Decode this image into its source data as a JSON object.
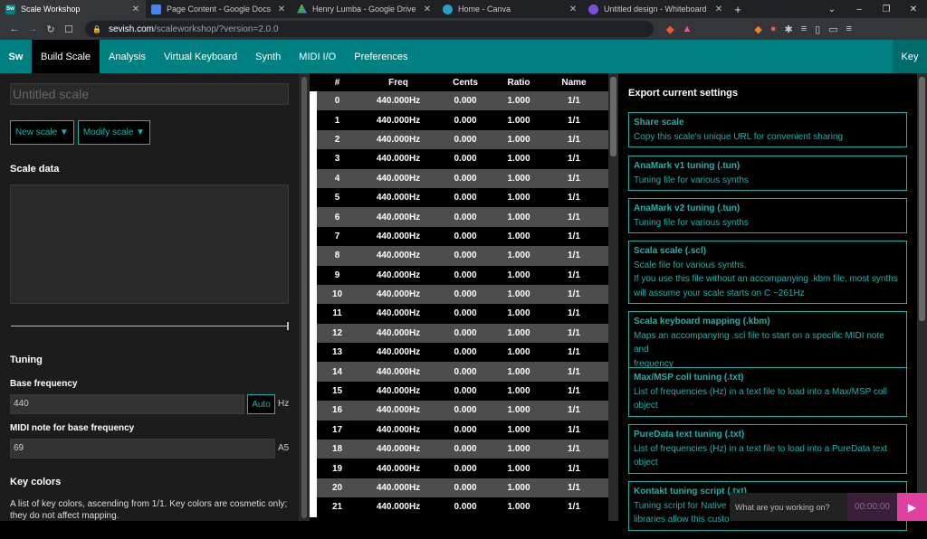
{
  "browser": {
    "tabs": [
      {
        "title": "Scale Workshop",
        "icon": "Sw",
        "active": true
      },
      {
        "title": "Page Content - Google Docs",
        "icon": "docs-icon",
        "active": false
      },
      {
        "title": "Henry Lumba - Google Drive",
        "icon": "drive-icon",
        "active": false
      },
      {
        "title": "Home - Canva",
        "icon": "canva-icon",
        "active": false
      },
      {
        "title": "Untitled design - Whiteboard",
        "icon": "canva-icon",
        "active": false
      }
    ],
    "url_host": "sevish.com",
    "url_path": "/scaleworkshop/?version=2.0.0"
  },
  "app": {
    "logo": "Sw",
    "nav": [
      "Build Scale",
      "Analysis",
      "Virtual Keyboard",
      "Synth",
      "MIDI I/O",
      "Preferences"
    ],
    "key_button": "Key"
  },
  "left": {
    "title_placeholder": "Untitled scale",
    "new_scale": "New scale ▼",
    "modify_scale": "Modify scale ▼",
    "scale_data_label": "Scale data",
    "tuning_label": "Tuning",
    "base_freq_label": "Base frequency",
    "base_freq_value": "440",
    "auto_button": "Auto",
    "hz_unit": "Hz",
    "midi_note_label": "MIDI note for base frequency",
    "midi_note_value": "69",
    "midi_note_name": "A5",
    "key_colors_label": "Key colors",
    "key_colors_desc": "A list of key colors, ascending from 1/1. Key colors are cosmetic only; they do not affect mapping."
  },
  "table": {
    "headers": [
      "#",
      "Freq",
      "Cents",
      "Ratio",
      "Name"
    ],
    "rows": [
      [
        "0",
        "440.000Hz",
        "0.000",
        "1.000",
        "1/1"
      ],
      [
        "1",
        "440.000Hz",
        "0.000",
        "1.000",
        "1/1"
      ],
      [
        "2",
        "440.000Hz",
        "0.000",
        "1.000",
        "1/1"
      ],
      [
        "3",
        "440.000Hz",
        "0.000",
        "1.000",
        "1/1"
      ],
      [
        "4",
        "440.000Hz",
        "0.000",
        "1.000",
        "1/1"
      ],
      [
        "5",
        "440.000Hz",
        "0.000",
        "1.000",
        "1/1"
      ],
      [
        "6",
        "440.000Hz",
        "0.000",
        "1.000",
        "1/1"
      ],
      [
        "7",
        "440.000Hz",
        "0.000",
        "1.000",
        "1/1"
      ],
      [
        "8",
        "440.000Hz",
        "0.000",
        "1.000",
        "1/1"
      ],
      [
        "9",
        "440.000Hz",
        "0.000",
        "1.000",
        "1/1"
      ],
      [
        "10",
        "440.000Hz",
        "0.000",
        "1.000",
        "1/1"
      ],
      [
        "11",
        "440.000Hz",
        "0.000",
        "1.000",
        "1/1"
      ],
      [
        "12",
        "440.000Hz",
        "0.000",
        "1.000",
        "1/1"
      ],
      [
        "13",
        "440.000Hz",
        "0.000",
        "1.000",
        "1/1"
      ],
      [
        "14",
        "440.000Hz",
        "0.000",
        "1.000",
        "1/1"
      ],
      [
        "15",
        "440.000Hz",
        "0.000",
        "1.000",
        "1/1"
      ],
      [
        "16",
        "440.000Hz",
        "0.000",
        "1.000",
        "1/1"
      ],
      [
        "17",
        "440.000Hz",
        "0.000",
        "1.000",
        "1/1"
      ],
      [
        "18",
        "440.000Hz",
        "0.000",
        "1.000",
        "1/1"
      ],
      [
        "19",
        "440.000Hz",
        "0.000",
        "1.000",
        "1/1"
      ],
      [
        "20",
        "440.000Hz",
        "0.000",
        "1.000",
        "1/1"
      ],
      [
        "21",
        "440.000Hz",
        "0.000",
        "1.000",
        "1/1"
      ]
    ]
  },
  "export": {
    "heading": "Export current settings",
    "cards": [
      {
        "title": "Share scale",
        "lines": [
          "Copy this scale's unique URL for convenient sharing"
        ]
      },
      {
        "title": "AnaMark v1 tuning (.tun)",
        "lines": [
          "Tuning file for various synths"
        ]
      },
      {
        "title": "AnaMark v2 tuning (.tun)",
        "lines": [
          "Tuning file for various synths"
        ]
      },
      {
        "title": "Scala scale (.scl)",
        "lines": [
          "Scale file for various synths.",
          "If you use this file without an accompanying .kbm file, most synths",
          "will assume your scale starts on C ~261Hz"
        ]
      },
      {
        "title": "Scala keyboard mapping (.kbm)",
        "lines": [
          "Maps an accompanying .scl file to start on a specific MIDI note and",
          "frequency"
        ]
      },
      {
        "title": "Max/MSP coll tuning (.txt)",
        "lines": [
          "List of frequencies (Hz) in a text file to load into a Max/MSP coll",
          "object"
        ]
      },
      {
        "title": "PureData text tuning (.txt)",
        "lines": [
          "List of frequencies (Hz) in a text file to load into a PureData text",
          "object"
        ]
      },
      {
        "title": "Kontakt tuning script (.txt)",
        "lines": [
          "Tuning script for Native",
          "libraries allow this custo"
        ]
      }
    ]
  },
  "timer": {
    "prompt": "What are you working on?",
    "time": "00:00:00"
  }
}
